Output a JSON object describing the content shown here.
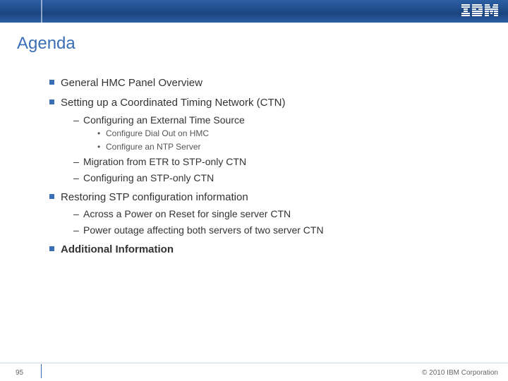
{
  "header": {
    "logo_alt": "IBM"
  },
  "title": "Agenda",
  "agenda": {
    "item1": "General HMC Panel Overview",
    "item2": "Setting up a Coordinated Timing Network (CTN)",
    "item2_sub1": "Configuring an External Time Source",
    "item2_sub1_a": "Configure Dial Out on HMC",
    "item2_sub1_b": "Configure an NTP Server",
    "item2_sub2": "Migration from ETR to STP-only CTN",
    "item2_sub3": "Configuring an STP-only CTN",
    "item3": "Restoring STP configuration information",
    "item3_sub1": "Across a Power on Reset for single server CTN",
    "item3_sub2": "Power outage affecting both servers of two server CTN",
    "item4": "Additional Information"
  },
  "footer": {
    "page": "95",
    "copyright": "© 2010 IBM Corporation"
  }
}
